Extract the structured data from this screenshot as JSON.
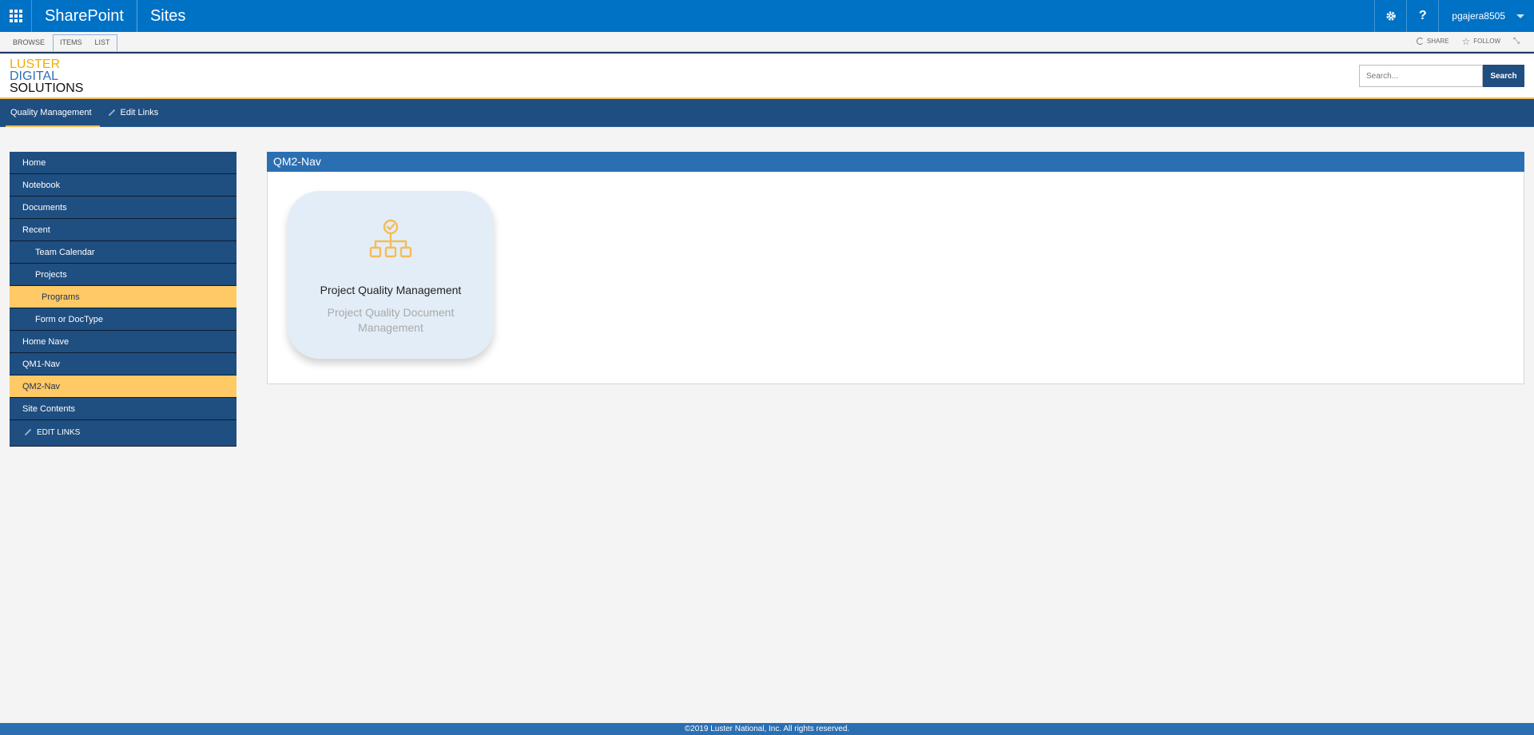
{
  "suitebar": {
    "brand": "SharePoint",
    "sites": "Sites",
    "help": "?",
    "user": "pgajera8505",
    "icons": {
      "app_launcher": "waffle-icon",
      "settings": "gear-icon",
      "help": "help-icon",
      "menu": "chevron-down-icon"
    }
  },
  "ribbon": {
    "tabs": [
      "BROWSE",
      "ITEMS",
      "LIST"
    ],
    "share": "SHARE",
    "follow": "FOLLOW"
  },
  "header": {
    "logo": {
      "line1": "LUSTER",
      "line2": "DIGITAL",
      "line3": "SOLUTIONS"
    },
    "search": {
      "placeholder": "Search...",
      "button": "Search"
    }
  },
  "topnav": {
    "items": [
      "Quality Management",
      "Edit Links"
    ]
  },
  "leftnav": {
    "items": [
      {
        "label": "Home",
        "level": 1,
        "active": false
      },
      {
        "label": "Notebook",
        "level": 1,
        "active": false
      },
      {
        "label": "Documents",
        "level": 1,
        "active": false
      },
      {
        "label": "Recent",
        "level": 1,
        "active": false
      },
      {
        "label": "Team Calendar",
        "level": 2,
        "active": false
      },
      {
        "label": "Projects",
        "level": 2,
        "active": false
      },
      {
        "label": "Programs",
        "level": 3,
        "active": true
      },
      {
        "label": "Form or DocType",
        "level": 2,
        "active": false
      },
      {
        "label": "Home Nave",
        "level": 1,
        "active": false
      },
      {
        "label": "QM1-Nav",
        "level": 1,
        "active": false
      },
      {
        "label": "QM2-Nav",
        "level": 1,
        "active": true
      },
      {
        "label": "Site Contents",
        "level": 1,
        "active": false
      }
    ],
    "edit_links": "EDIT LINKS"
  },
  "main": {
    "title": "QM2-Nav",
    "tile": {
      "title": "Project Quality Management",
      "subtitle": "Project Quality Document Management",
      "icon": "org-chart-icon"
    }
  },
  "footer": {
    "text": "©2019 Luster National, Inc. All rights reserved."
  },
  "colors": {
    "suitebar": "#0072c6",
    "nav": "#1f4e80",
    "accent": "#f1bb54",
    "active_nav": "#ffc966",
    "webpart_title": "#2b6fb3",
    "tile_bg": "#e3edf7"
  }
}
